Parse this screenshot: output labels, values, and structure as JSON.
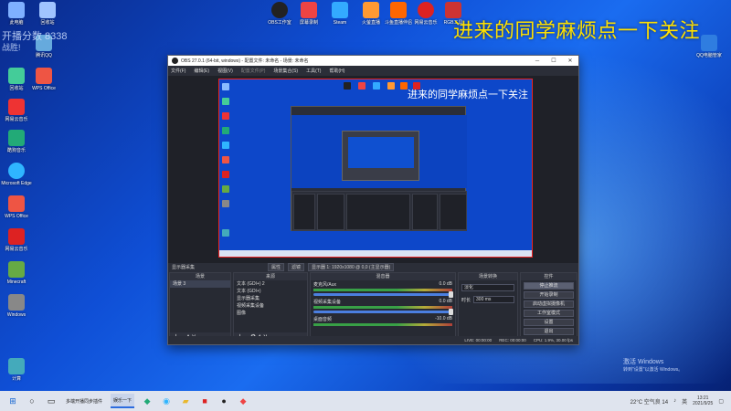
{
  "overlay": {
    "text": "进来的同学麻烦点一下关注",
    "score": "开播分数 8338",
    "score_sub": "战胜!"
  },
  "desktop_icons": [
    {
      "label": "此电脑",
      "color": "#7fb0ff"
    },
    {
      "label": "回收站",
      "color": "#a0c4ff"
    },
    {
      "label": "Microsoft Edge",
      "color": "#2fb5ff"
    },
    {
      "label": "腾讯QQ",
      "color": "#6ad"
    },
    {
      "label": "WPS Office",
      "color": "#e54"
    },
    {
      "label": "回收站",
      "color": "#4c9"
    },
    {
      "label": "酷狗音乐",
      "color": "#2a7"
    },
    {
      "label": "网易云音乐",
      "color": "#e33"
    },
    {
      "label": "Minecraft",
      "color": "#6a4"
    },
    {
      "label": "Windows",
      "color": "#888"
    },
    {
      "label": "计算",
      "color": "#4ab"
    }
  ],
  "top_icons": [
    {
      "label": "OBS工作室",
      "color": "#222"
    },
    {
      "label": "屏幕录制",
      "color": "#e44"
    },
    {
      "label": "Steam",
      "color": "#3af"
    },
    {
      "label": "火萤直播",
      "color": "#f93"
    },
    {
      "label": "斗鱼直播伴侣",
      "color": "#f60"
    },
    {
      "label": "网易云音乐",
      "color": "#d22"
    },
    {
      "label": "RGB工具",
      "color": "#c33"
    }
  ],
  "right_icon": {
    "label": "QQ电脑管家",
    "color": "#2f7de0"
  },
  "obs": {
    "title": "OBS 27.0.1 (64-bit, windows) - 配置文件: 未命名 - 场景: 未命名",
    "menus": [
      "文件(F)",
      "编辑(E)",
      "视图(V)",
      "配置文件(P)",
      "场景集合(S)",
      "工具(T)",
      "帮助(H)"
    ],
    "canvas_text": "进来的同学麻烦点一下关注",
    "source_bar": {
      "label": "显示器采集",
      "btn1": "属性",
      "btn2": "滤镜",
      "monitor": "显示器 1: 1920x1080 @ 0,0 (主显示器)"
    },
    "docks": {
      "scenes_header": "场景",
      "scenes": [
        "场景 3"
      ],
      "sources_header": "来源",
      "sources": [
        "文本 (GDI+) 2",
        "文本 (GDI+)",
        "显示器采集",
        "视频采集设备",
        "图像"
      ],
      "mixer_header": "混音器",
      "mixer": [
        {
          "name": "麦克风/Aux",
          "level": "0.0 dB"
        },
        {
          "name": "视频采集设备",
          "level": "0.0 dB"
        },
        {
          "name": "桌面音频",
          "level": "-10.0 dB"
        }
      ],
      "transitions_header": "场景转换",
      "transition": "淡化",
      "duration_label": "时长",
      "duration": "300 ms",
      "controls_header": "控件",
      "controls": [
        "停止推流",
        "开始录制",
        "启动虚拟摄像机",
        "工作室模式",
        "设置",
        "退出"
      ]
    },
    "status": {
      "live": "LIVE: 00:00:00",
      "rec": "REC: 00:00:00",
      "cpu": "CPU: 1.9%, 30.00 fps"
    }
  },
  "taskbar": {
    "items": [
      "多端开播同步插件",
      "娱乐一下"
    ],
    "weather": "22°C 空气良 14",
    "time": "13:21",
    "date": "2021/9/25",
    "lang": "英"
  },
  "activate": {
    "title": "激活 Windows",
    "sub": "转到\"设置\"以激活 Windows。"
  }
}
